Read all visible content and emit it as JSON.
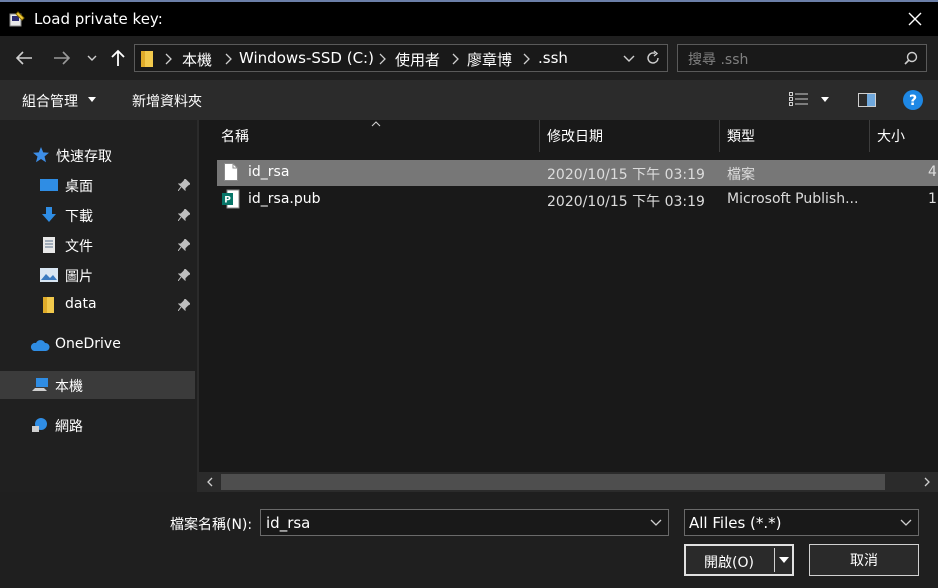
{
  "window": {
    "title": "Load private key:"
  },
  "address": {
    "crumbs": [
      "本機",
      "Windows-SSD (C:)",
      "使用者",
      "廖章博",
      ".ssh"
    ],
    "search_placeholder": "搜尋 .ssh"
  },
  "toolbar": {
    "organize_label": "組合管理",
    "new_folder_label": "新增資料夾"
  },
  "sidebar": {
    "quick_access": "快速存取",
    "items": [
      {
        "label": "桌面",
        "icon": "desktop-icon",
        "pinned": true
      },
      {
        "label": "下載",
        "icon": "download-icon",
        "pinned": true
      },
      {
        "label": "文件",
        "icon": "document-icon",
        "pinned": true
      },
      {
        "label": "圖片",
        "icon": "picture-icon",
        "pinned": true
      },
      {
        "label": "data",
        "icon": "folder-icon",
        "pinned": true
      }
    ],
    "onedrive": "OneDrive",
    "this_pc": "本機",
    "network": "網路"
  },
  "columns": {
    "name": "名稱",
    "modified": "修改日期",
    "type": "類型",
    "size": "大小"
  },
  "files": [
    {
      "name": "id_rsa",
      "modified": "2020/10/15 下午 03:19",
      "type": "檔案",
      "size": "4",
      "selected": true,
      "icon": "file-icon"
    },
    {
      "name": "id_rsa.pub",
      "modified": "2020/10/15 下午 03:19",
      "type": "Microsoft Publish...",
      "size": "1",
      "selected": false,
      "icon": "publisher-file-icon"
    }
  ],
  "bottom": {
    "filename_label": "檔案名稱(N):",
    "filename_value": "id_rsa",
    "filter_value": "All Files (*.*)",
    "open_label": "開啟(O)",
    "cancel_label": "取消"
  },
  "colors": {
    "selection": "#777777",
    "accent_blue": "#1e88e5",
    "background": "#191919"
  }
}
